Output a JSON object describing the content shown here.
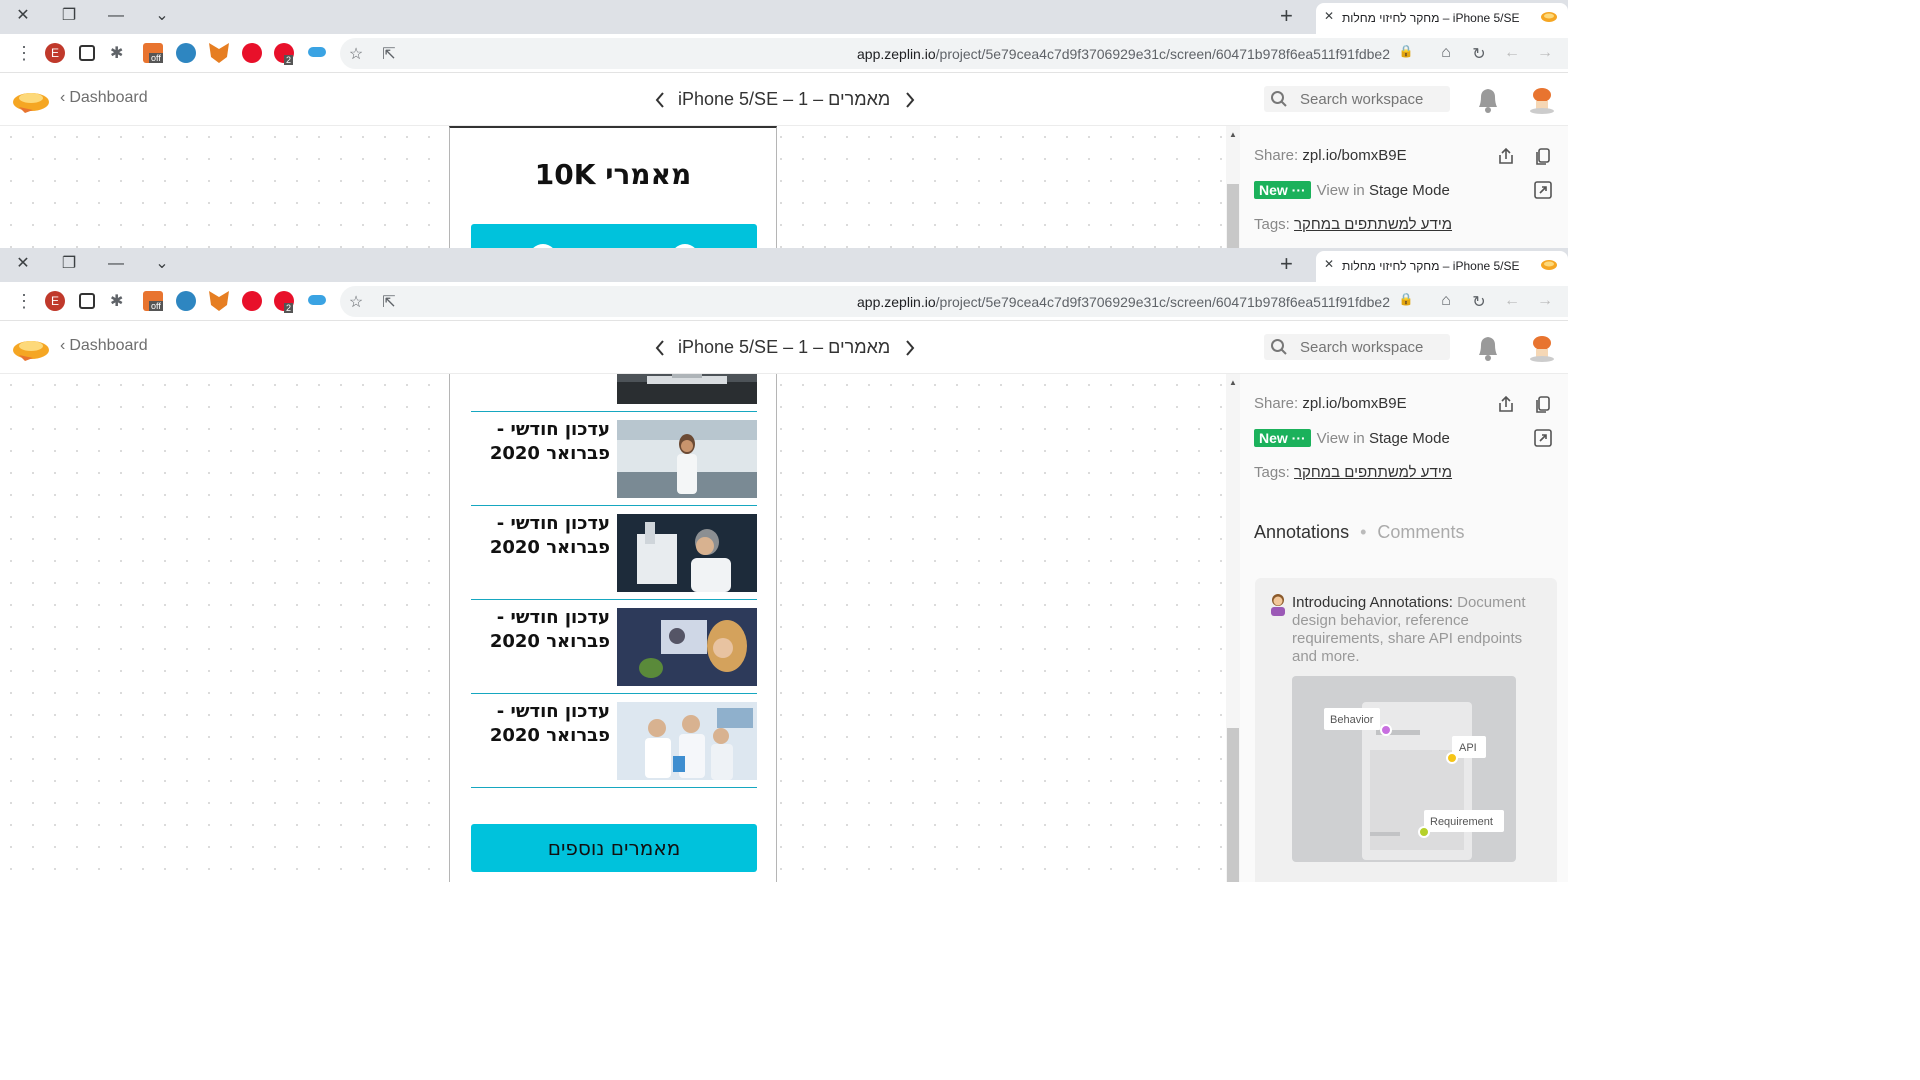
{
  "browser": {
    "tab_title": "מחקר לחיזוי מחלות – iPhone 5/SE",
    "url_host": "app.zeplin.io",
    "url_path": "/project/5e79cea4c7d9f3706929e31c/screen/60471b978f6ea511f91fdbe2",
    "extension_badges": {
      "off": "off",
      "abp_count": "2",
      "e_letter": "E"
    }
  },
  "header": {
    "back_label": "Dashboard",
    "screen_name": "iPhone 5/SE – 1 – מאמרים",
    "search_placeholder": "Search workspace"
  },
  "panel": {
    "share_label": "Share:",
    "share_link": "zpl.io/bomxB9E",
    "new_badge": "New ···",
    "view_in": "View in",
    "stage_mode": "Stage Mode",
    "tags_label": "Tags:",
    "tag_value": "מידע למשתתפים במחקר",
    "tabs": {
      "annotations": "Annotations",
      "comments": "Comments"
    },
    "intro_title": "Introducing Annotations:",
    "intro_body": "Document design behavior, reference requirements, share API endpoints and more.",
    "illustration_labels": {
      "behavior": "Behavior",
      "api": "API",
      "requirement": "Requirement"
    }
  },
  "artboard_top": {
    "title": "מאמרי 10K"
  },
  "articles": [
    {
      "title": "עדכון חודשי - פברואר 2020",
      "image": "scientist-smiling-lab-photo"
    },
    {
      "title": "עדכון חודשי - פברואר 2020",
      "image": "scientist-microscope-photo"
    },
    {
      "title": "עדכון חודשי - פברואר 2020",
      "image": "researcher-monitor-photo"
    },
    {
      "title": "עדכון חודשי - פברואר 2020",
      "image": "lab-team-photo"
    }
  ],
  "more_button": "מאמרים נוספים",
  "colors": {
    "accent": "#00c2dc",
    "new_badge": "#1bb15b",
    "tab_strip": "#dee1e6"
  }
}
